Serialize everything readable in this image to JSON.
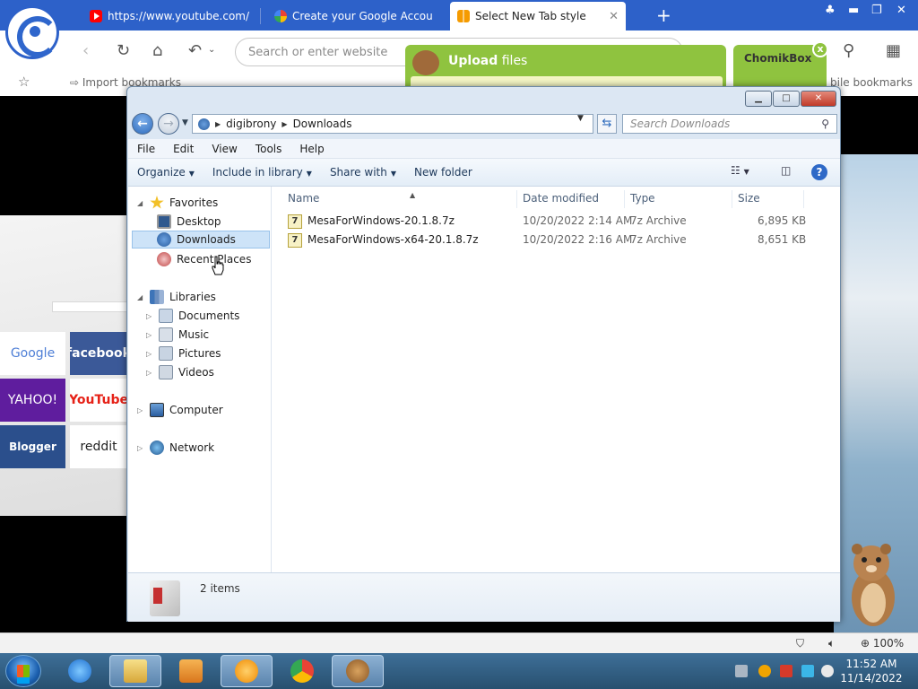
{
  "browser": {
    "tabs": [
      {
        "label": "https://www.youtube.com/",
        "icon": "youtube-icon"
      },
      {
        "label": "Create your Google Accou",
        "icon": "google-icon"
      },
      {
        "label": "Select New Tab style",
        "icon": "tiles-icon"
      }
    ],
    "url_placeholder": "Search or enter website",
    "bookmarks": {
      "import_label": "Import bookmarks",
      "mobile_label": "bile bookmarks"
    }
  },
  "upload_widget": {
    "title_bold": "Upload",
    "title_rest": " files"
  },
  "chomikbox": {
    "label": "ChomikBox",
    "close_glyph": "x"
  },
  "page_tiles": [
    "Google",
    "facebook",
    "YAHOO!",
    "YouTube",
    "Blogger",
    "reddit"
  ],
  "explorer": {
    "breadcrumb": [
      "digibrony",
      "Downloads"
    ],
    "search_placeholder": "Search Downloads",
    "menu": [
      "File",
      "Edit",
      "View",
      "Tools",
      "Help"
    ],
    "commands": [
      "Organize",
      "Include in library",
      "Share with",
      "New folder"
    ],
    "nav": {
      "favorites": "Favorites",
      "desktop": "Desktop",
      "downloads": "Downloads",
      "recent": "Recent Places",
      "libraries": "Libraries",
      "documents": "Documents",
      "music": "Music",
      "pictures": "Pictures",
      "videos": "Videos",
      "computer": "Computer",
      "network": "Network"
    },
    "columns": [
      "Name",
      "Date modified",
      "Type",
      "Size"
    ],
    "files": [
      {
        "name": "MesaForWindows-20.1.8.7z",
        "date": "10/20/2022 2:14 AM",
        "type": "7z Archive",
        "size": "6,895 KB"
      },
      {
        "name": "MesaForWindows-x64-20.1.8.7z",
        "date": "10/20/2022 2:16 AM",
        "type": "7z Archive",
        "size": "8,651 KB"
      }
    ],
    "item_count": "2 items"
  },
  "status": {
    "zoom": "100%"
  },
  "taskbar": {
    "time": "11:52 AM",
    "date": "11/14/2022"
  },
  "colors": {
    "browser_blue": "#2d61c9",
    "chomik_green": "#8fc33f",
    "taskbar": "#3e6f98"
  }
}
